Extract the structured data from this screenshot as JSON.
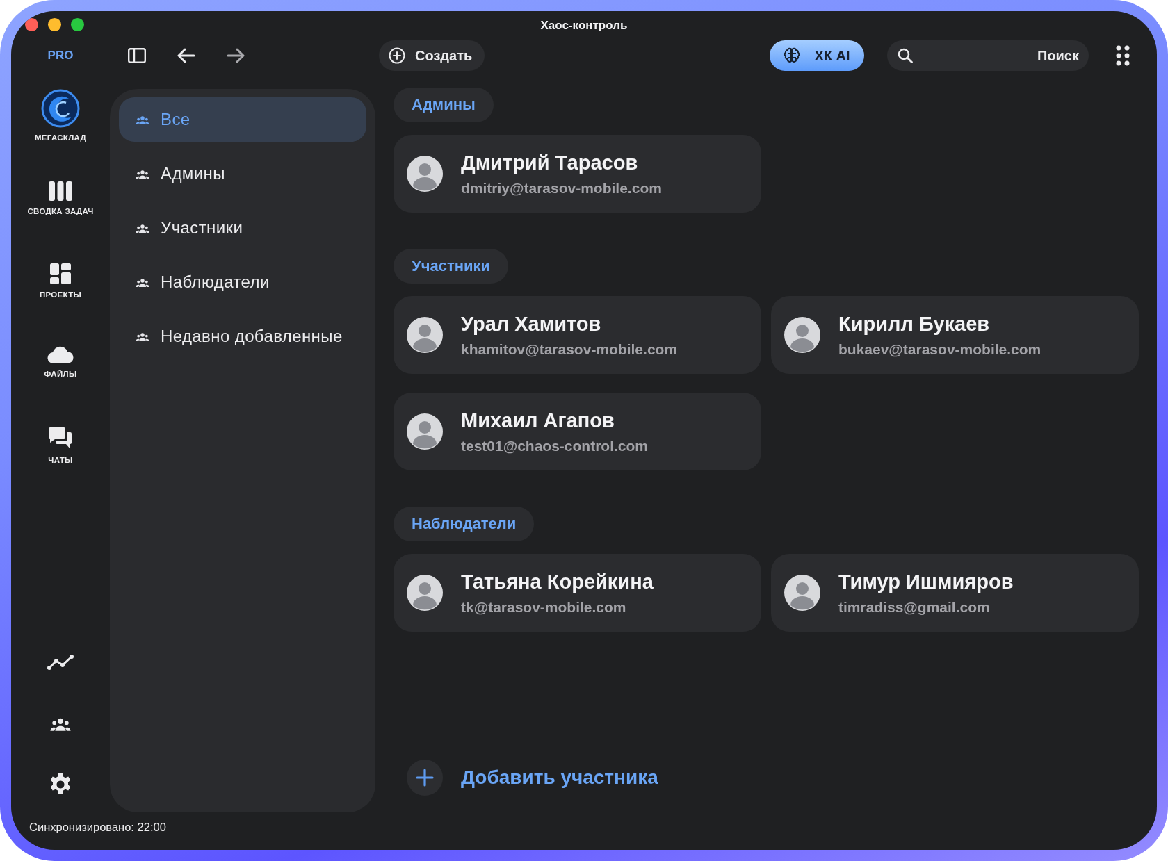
{
  "window": {
    "title": "Хаос-контроль"
  },
  "toolbar": {
    "plan_badge": "PRO",
    "create_button": "Создать",
    "ai_button": "ХК AI",
    "search": {
      "placeholder": "Поиск"
    }
  },
  "rail": {
    "items": [
      {
        "kind": "logo",
        "label": "МЕГАСКЛАД"
      },
      {
        "kind": "board",
        "label": "СВОДКА ЗАДАЧ"
      },
      {
        "kind": "projects",
        "label": "ПРОЕКТЫ"
      },
      {
        "kind": "files",
        "label": "ФАЙЛЫ"
      },
      {
        "kind": "chats",
        "label": "ЧАТЫ"
      }
    ],
    "bottom_items": [
      {
        "kind": "chart"
      },
      {
        "kind": "people"
      },
      {
        "kind": "settings"
      }
    ]
  },
  "sidebar": {
    "items": [
      {
        "label": "Все",
        "selected": true
      },
      {
        "label": "Админы",
        "selected": false
      },
      {
        "label": "Участники",
        "selected": false
      },
      {
        "label": "Наблюдатели",
        "selected": false
      },
      {
        "label": "Недавно добавленные",
        "selected": false
      }
    ]
  },
  "sections": [
    {
      "title": "Админы",
      "members": [
        {
          "name": "Дмитрий Тарасов",
          "email": "dmitriy@tarasov-mobile.com"
        }
      ]
    },
    {
      "title": "Участники",
      "members": [
        {
          "name": "Урал Хамитов",
          "email": "khamitov@tarasov-mobile.com"
        },
        {
          "name": "Кирилл Букаев",
          "email": "bukaev@tarasov-mobile.com"
        },
        {
          "name": "Михаил Агапов",
          "email": "test01@chaos-control.com"
        }
      ]
    },
    {
      "title": "Наблюдатели",
      "members": [
        {
          "name": "Татьяна Корейкина",
          "email": "tk@tarasov-mobile.com"
        },
        {
          "name": "Тимур Ишмияров",
          "email": "timradiss@gmail.com"
        }
      ]
    }
  ],
  "add_button": "Добавить участника",
  "status_bar": "Синхронизировано: 22:00"
}
